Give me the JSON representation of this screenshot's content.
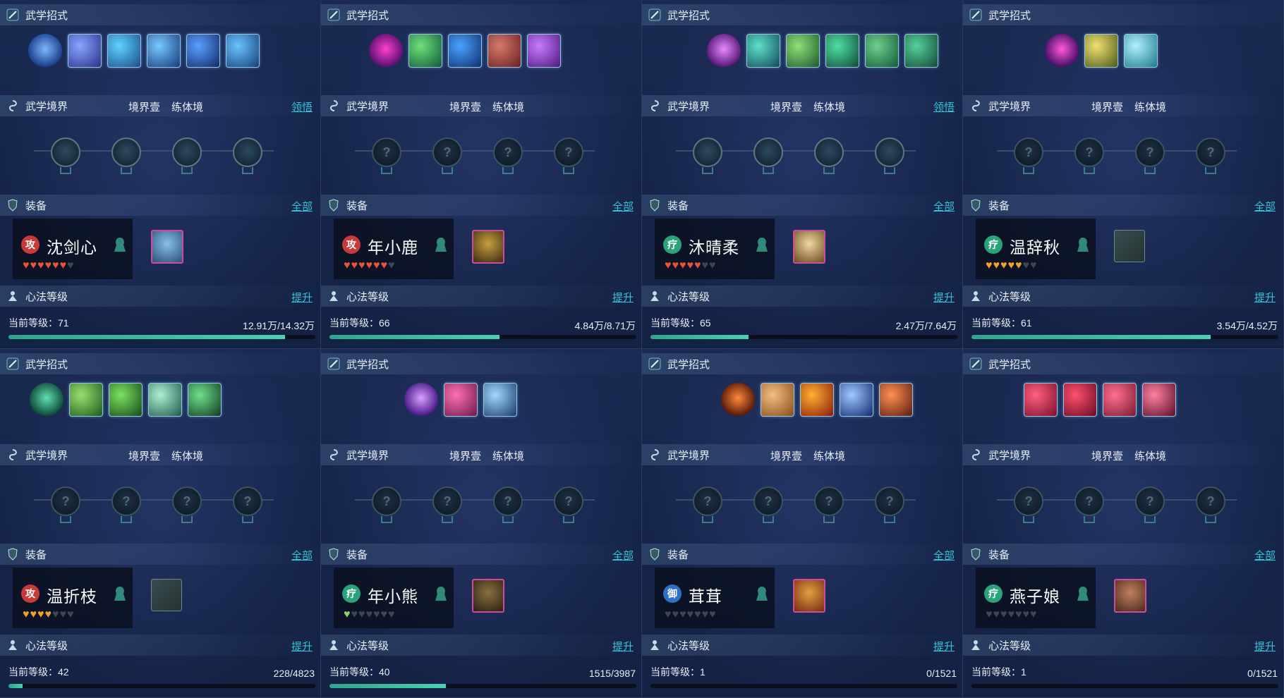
{
  "labels": {
    "moves": "武学招式",
    "realm": "武学境界",
    "realm_level": "境界壹",
    "realm_stage": "练体境",
    "comprehend": "领悟",
    "equipment": "装备",
    "all": "全部",
    "heart_method": "心法等级",
    "upgrade": "提升",
    "current_level": "当前等级："
  },
  "colors": {
    "accent": "#35c3d8",
    "bar_fill": "#3ebf9f",
    "heart_red": "#e8533b",
    "heart_orange": "#f0a030",
    "heart_green": "#8fd06a",
    "heart_empty": "#3d4655",
    "role_attack": "#c83a3a",
    "role_heal": "#2aa27a",
    "role_defend": "#2e6fc8"
  },
  "cards": [
    {
      "name": "沈剑心",
      "role": "攻",
      "role_type": "attack",
      "hearts": [
        1,
        1,
        1,
        1,
        1,
        1,
        0
      ],
      "heart_color": "red",
      "level": "71",
      "exp": "12.91万/14.32万",
      "progress": 0.9,
      "show_comprehend": true,
      "skills": [
        {
          "icon": "spiral-blue-icon",
          "c1": "#7fb6ff",
          "c2": "#1c3f8a",
          "passive": true
        },
        {
          "icon": "sword-flash-icon",
          "c1": "#8aa6ff",
          "c2": "#2b2f8a"
        },
        {
          "icon": "whirl-blue-icon",
          "c1": "#5ed3ff",
          "c2": "#1b4b8a"
        },
        {
          "icon": "blade-arc-icon",
          "c1": "#77c8ff",
          "c2": "#143a7a"
        },
        {
          "icon": "sword-pierce-icon",
          "c1": "#5aa0ff",
          "c2": "#0f2a66"
        },
        {
          "icon": "slash-blue-icon",
          "c1": "#6ac4ff",
          "c2": "#14407a"
        }
      ],
      "realm_nodes": [
        "feather-icon",
        "swirl-icon",
        "blade-icon",
        "sword-icon"
      ],
      "realm_revealed": true,
      "equip": {
        "icon": "armor-icon",
        "c1": "#86c0e8",
        "c2": "#2d4f78",
        "empty": false
      }
    },
    {
      "name": "年小鹿",
      "role": "攻",
      "role_type": "attack",
      "hearts": [
        1,
        1,
        1,
        1,
        1,
        1,
        0
      ],
      "heart_color": "red",
      "level": "66",
      "exp": "4.84万/8.71万",
      "progress": 0.555,
      "show_comprehend": false,
      "skills": [
        {
          "icon": "vortex-purple-icon",
          "c1": "#ff3fd0",
          "c2": "#5a1070",
          "passive": true
        },
        {
          "icon": "leaf-burst-icon",
          "c1": "#6ee07a",
          "c2": "#0f5a3a"
        },
        {
          "icon": "water-wave-icon",
          "c1": "#4aa2ff",
          "c2": "#0e2f70"
        },
        {
          "icon": "rock-flesh-icon",
          "c1": "#d47a6a",
          "c2": "#6a1f22"
        },
        {
          "icon": "purple-slash-icon",
          "c1": "#c87aff",
          "c2": "#4a1a7a"
        }
      ],
      "realm_nodes": [
        "question-icon",
        "question-icon",
        "question-icon",
        "question-icon"
      ],
      "realm_revealed": false,
      "equip": {
        "icon": "gold-armor-icon",
        "c1": "#c9a040",
        "c2": "#3a2a12",
        "empty": false
      }
    },
    {
      "name": "沐晴柔",
      "role": "疗",
      "role_type": "heal",
      "hearts": [
        1,
        1,
        1,
        1,
        1,
        0,
        0
      ],
      "heart_color": "red",
      "level": "65",
      "exp": "2.47万/7.64万",
      "progress": 0.32,
      "show_comprehend": true,
      "skills": [
        {
          "icon": "dancer-purple-icon",
          "c1": "#e58aff",
          "c2": "#5a1a7a",
          "passive": true
        },
        {
          "icon": "water-splash-icon",
          "c1": "#5ee0c8",
          "c2": "#0f4a5a"
        },
        {
          "icon": "green-wind-icon",
          "c1": "#8fe07a",
          "c2": "#1c5a2a"
        },
        {
          "icon": "green-vortex-icon",
          "c1": "#4fe0a0",
          "c2": "#0f4a3a"
        },
        {
          "icon": "leaf-blade-icon",
          "c1": "#6ed08a",
          "c2": "#115a3a"
        },
        {
          "icon": "green-swirl-icon",
          "c1": "#58d09a",
          "c2": "#0f4a36"
        }
      ],
      "realm_nodes": [
        "lotus-icon",
        "moon-icon",
        "wave-icon",
        "crown-icon"
      ],
      "realm_revealed": true,
      "equip": {
        "icon": "white-gold-armor-icon",
        "c1": "#f0d8a0",
        "c2": "#6a4a20",
        "empty": false
      }
    },
    {
      "name": "温辞秋",
      "role": "疗",
      "role_type": "heal",
      "hearts": [
        1,
        1,
        1,
        1,
        1,
        0,
        0
      ],
      "heart_color": "orange",
      "level": "61",
      "exp": "3.54万/4.52万",
      "progress": 0.78,
      "show_comprehend": false,
      "skills": [
        {
          "icon": "magic-sigil-icon",
          "c1": "#ff5ad8",
          "c2": "#4a0f6a",
          "passive": true
        },
        {
          "icon": "golden-rays-icon",
          "c1": "#f0e070",
          "c2": "#4a5a1a"
        },
        {
          "icon": "sun-ring-icon",
          "c1": "#b0f0ff",
          "c2": "#1a7a8a"
        }
      ],
      "realm_nodes": [
        "question-icon",
        "question-icon",
        "question-icon",
        "question-icon"
      ],
      "realm_revealed": false,
      "equip": {
        "icon": "empty-slot-icon",
        "c1": "#3a4c4e",
        "c2": "#243334",
        "empty": true
      }
    },
    {
      "name": "温折枝",
      "role": "攻",
      "role_type": "attack",
      "hearts": [
        1,
        1,
        1,
        1,
        0,
        0,
        0
      ],
      "heart_color": "orange",
      "level": "42",
      "exp": "228/4823",
      "progress": 0.047,
      "show_comprehend": false,
      "skills": [
        {
          "icon": "green-figure-icon",
          "c1": "#60e0b0",
          "c2": "#0f4a3a",
          "passive": true
        },
        {
          "icon": "green-claw-icon",
          "c1": "#9ae070",
          "c2": "#1a5a1a"
        },
        {
          "icon": "green-dash-icon",
          "c1": "#7ee060",
          "c2": "#134a1a"
        },
        {
          "icon": "green-ring-icon",
          "c1": "#b0f0d0",
          "c2": "#1a5a4a"
        },
        {
          "icon": "yin-yang-icon",
          "c1": "#70e08a",
          "c2": "#0f3a22"
        }
      ],
      "realm_nodes": [
        "question-icon",
        "question-icon",
        "question-icon",
        "question-icon"
      ],
      "realm_revealed": false,
      "equip": {
        "icon": "empty-slot-icon",
        "c1": "#3a4c4e",
        "c2": "#243334",
        "empty": true
      }
    },
    {
      "name": "年小熊",
      "role": "疗",
      "role_type": "heal",
      "hearts": [
        1,
        0,
        0,
        0,
        0,
        0,
        0
      ],
      "heart_color": "green",
      "level": "40",
      "exp": "1515/3987",
      "progress": 0.38,
      "show_comprehend": false,
      "skills": [
        {
          "icon": "purple-crystal-icon",
          "c1": "#d6a0ff",
          "c2": "#4a1a8a",
          "passive": true
        },
        {
          "icon": "fox-pink-icon",
          "c1": "#ff70b0",
          "c2": "#6a1a4a"
        },
        {
          "icon": "ice-shard-icon",
          "c1": "#a0d8ff",
          "c2": "#1a3a6a"
        }
      ],
      "realm_nodes": [
        "question-icon",
        "question-icon",
        "question-icon",
        "question-icon"
      ],
      "realm_revealed": false,
      "equip": {
        "icon": "dark-armor-icon",
        "c1": "#8a7040",
        "c2": "#2a2010",
        "empty": false
      }
    },
    {
      "name": "茸茸",
      "role": "御",
      "role_type": "defend",
      "hearts": [
        0,
        0,
        0,
        0,
        0,
        0,
        0
      ],
      "heart_color": "red",
      "level": "1",
      "exp": "0/1521",
      "progress": 0,
      "show_comprehend": false,
      "skills": [
        {
          "icon": "flame-figure-icon",
          "c1": "#ff8a3a",
          "c2": "#5a1a0a",
          "passive": true
        },
        {
          "icon": "buddha-face-icon",
          "c1": "#f0c080",
          "c2": "#8a4a1a"
        },
        {
          "icon": "fire-burst-icon",
          "c1": "#ffb030",
          "c2": "#8a1a0a"
        },
        {
          "icon": "blue-moon-icon",
          "c1": "#a0c8ff",
          "c2": "#0f2a70"
        },
        {
          "icon": "fire-swirl-icon",
          "c1": "#ff9050",
          "c2": "#5a1a12"
        }
      ],
      "realm_nodes": [
        "question-icon",
        "question-icon",
        "question-icon",
        "question-icon"
      ],
      "realm_revealed": false,
      "equip": {
        "icon": "gold-red-armor-icon",
        "c1": "#e0a040",
        "c2": "#7a2a10",
        "empty": false
      }
    },
    {
      "name": "燕子娘",
      "role": "疗",
      "role_type": "heal",
      "hearts": [
        0,
        0,
        0,
        0,
        0,
        0,
        0
      ],
      "heart_color": "red",
      "level": "1",
      "exp": "0/1521",
      "progress": 0,
      "show_comprehend": false,
      "skills": [
        {
          "icon": "red-slash-icon",
          "c1": "#ff6080",
          "c2": "#7a0f2a"
        },
        {
          "icon": "red-claw-icon",
          "c1": "#ff5070",
          "c2": "#6a0a22"
        },
        {
          "icon": "rose-icon",
          "c1": "#ff7090",
          "c2": "#7a1a30"
        },
        {
          "icon": "red-dancer-icon",
          "c1": "#ff80a0",
          "c2": "#5a0f2a"
        }
      ],
      "realm_nodes": [
        "question-icon",
        "question-icon",
        "question-icon",
        "question-icon"
      ],
      "realm_revealed": false,
      "equip": {
        "icon": "leather-armor-icon",
        "c1": "#c08060",
        "c2": "#4a2a1a",
        "empty": false
      }
    }
  ]
}
